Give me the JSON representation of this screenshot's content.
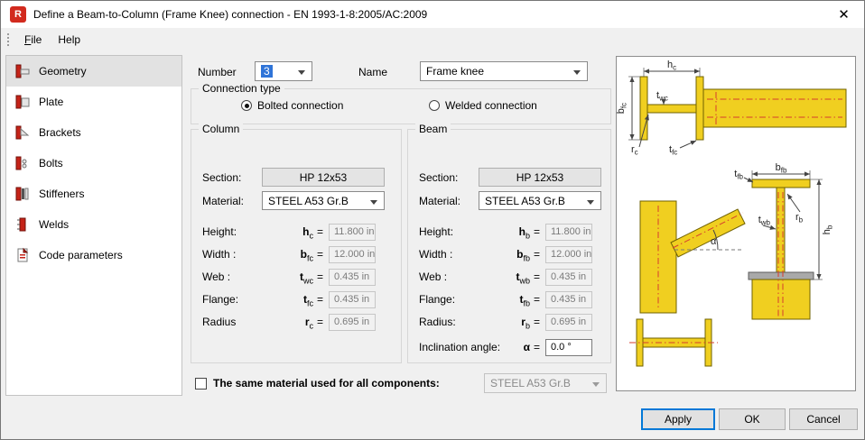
{
  "window": {
    "title": "Define a Beam-to-Column (Frame Knee) connection - EN 1993-1-8:2005/AC:2009",
    "app_icon_letter": "R",
    "close_glyph": "✕"
  },
  "menu": {
    "items": [
      {
        "label": "File"
      },
      {
        "label": "Help"
      }
    ]
  },
  "sidebar": {
    "items": [
      {
        "label": "Geometry"
      },
      {
        "label": "Plate"
      },
      {
        "label": "Brackets"
      },
      {
        "label": "Bolts"
      },
      {
        "label": "Stiffeners"
      },
      {
        "label": "Welds"
      },
      {
        "label": "Code parameters"
      }
    ]
  },
  "header": {
    "number_label": "Number",
    "number_value": "3",
    "name_label": "Name",
    "name_value": "Frame knee"
  },
  "connection": {
    "group_label": "Connection type",
    "options": [
      {
        "label": "Bolted connection",
        "checked": true
      },
      {
        "label": "Welded connection",
        "checked": false
      }
    ]
  },
  "column": {
    "group_label": "Column",
    "section_label": "Section:",
    "section_value": "HP 12x53",
    "material_label": "Material:",
    "material_value": "STEEL A53 Gr.B",
    "rows": [
      {
        "label": "Height:",
        "sym": "h",
        "sub": "c",
        "value": "11.800 in"
      },
      {
        "label": "Width :",
        "sym": "b",
        "sub": "fc",
        "value": "12.000 in"
      },
      {
        "label": "Web :",
        "sym": "t",
        "sub": "wc",
        "value": "0.435 in"
      },
      {
        "label": "Flange:",
        "sym": "t",
        "sub": "fc",
        "value": "0.435 in"
      },
      {
        "label": "Radius",
        "sym": "r",
        "sub": "c",
        "value": "0.695 in"
      }
    ]
  },
  "beam": {
    "group_label": "Beam",
    "section_label": "Section:",
    "section_value": "HP 12x53",
    "material_label": "Material:",
    "material_value": "STEEL A53 Gr.B",
    "rows": [
      {
        "label": "Height:",
        "sym": "h",
        "sub": "b",
        "value": "11.800 in"
      },
      {
        "label": "Width :",
        "sym": "b",
        "sub": "fb",
        "value": "12.000 in"
      },
      {
        "label": "Web :",
        "sym": "t",
        "sub": "wb",
        "value": "0.435 in"
      },
      {
        "label": "Flange:",
        "sym": "t",
        "sub": "fb",
        "value": "0.435 in"
      },
      {
        "label": "Radius:",
        "sym": "r",
        "sub": "b",
        "value": "0.695 in"
      }
    ],
    "inclination": {
      "label": "Inclination angle:",
      "sym": "α",
      "value": "0.0 °"
    }
  },
  "footer": {
    "same_material_label": "The same material used for all components:",
    "same_material_value": "STEEL A53 Gr.B"
  },
  "buttons": {
    "apply": "Apply",
    "ok": "OK",
    "cancel": "Cancel"
  },
  "misc": {
    "equals": "="
  },
  "colors": {
    "accent": "#0078d7",
    "steel_yellow": "#f0cf20",
    "icon_red": "#d22a1e",
    "centerline_red": "#d63c2e"
  },
  "diagram": {
    "labels": [
      {
        "main": "h",
        "sub": "c"
      },
      {
        "main": "b",
        "sub": "fc"
      },
      {
        "main": "t",
        "sub": "wc"
      },
      {
        "main": "t",
        "sub": "fc"
      },
      {
        "main": "r",
        "sub": "c"
      },
      {
        "main": "b",
        "sub": "fb"
      },
      {
        "main": "t",
        "sub": "fb"
      },
      {
        "main": "t",
        "sub": "wb"
      },
      {
        "main": "r",
        "sub": "b"
      },
      {
        "main": "h",
        "sub": "b"
      },
      {
        "main": "α",
        "sub": ""
      }
    ]
  }
}
